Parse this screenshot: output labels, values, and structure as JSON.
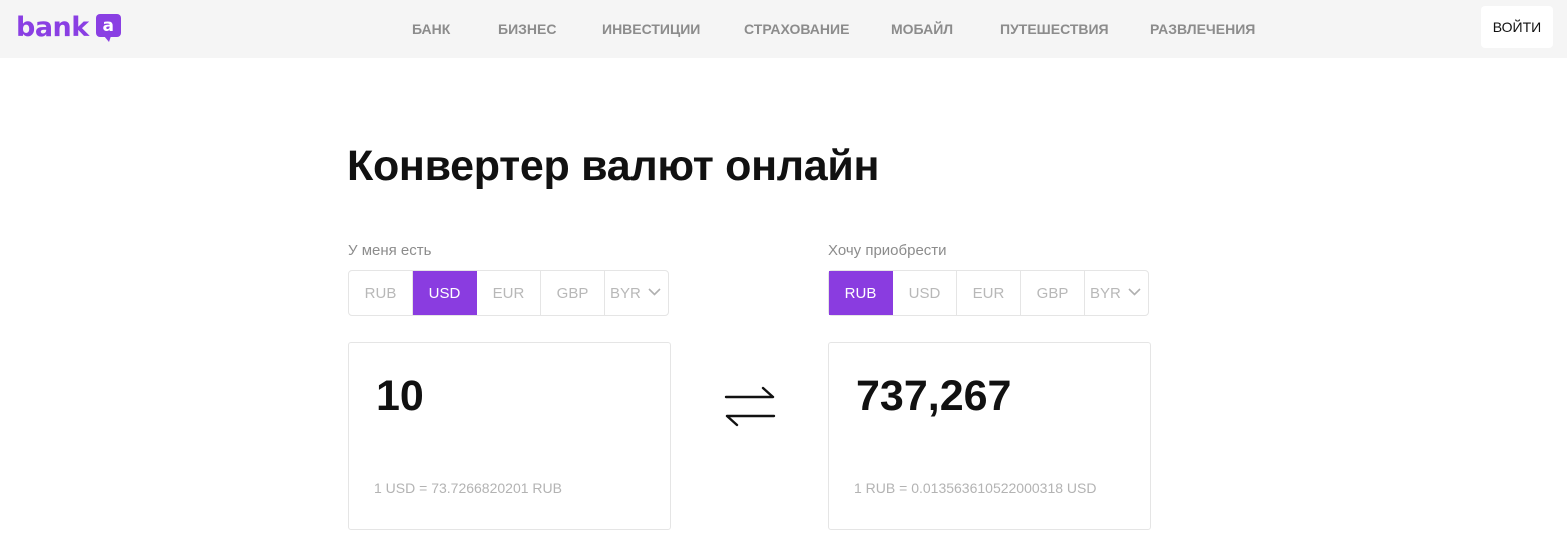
{
  "header": {
    "logo_text": "bank",
    "logo_badge": "a",
    "nav": [
      "БАНК",
      "БИЗНЕС",
      "ИНВЕСТИЦИИ",
      "СТРАХОВАНИЕ",
      "МОБАЙЛ",
      "ПУТЕШЕСТВИЯ",
      "РАЗВЛЕЧЕНИЯ"
    ],
    "login_label": "ВОЙТИ"
  },
  "page_title": "Конвертер валют онлайн",
  "from": {
    "label": "У меня есть",
    "currencies": [
      "RUB",
      "USD",
      "EUR",
      "GBP"
    ],
    "selected": "USD",
    "dropdown_value": "BYR",
    "amount": "10",
    "rate": "1 USD = 73.7266820201 RUB"
  },
  "to": {
    "label": "Хочу приобрести",
    "currencies": [
      "RUB",
      "USD",
      "EUR",
      "GBP"
    ],
    "selected": "RUB",
    "dropdown_value": "BYR",
    "amount": "737,267",
    "rate": "1 RUB = 0.013563610522000318 USD"
  },
  "colors": {
    "accent": "#8a3ce0",
    "header_bg": "#f5f5f5",
    "nav_text": "#8c8c8c",
    "muted_text": "#b8b8b8"
  },
  "icons": {
    "swap": "swap-arrows-icon",
    "dropdown": "chevron-down-icon",
    "logo": "bank-logo-badge"
  }
}
